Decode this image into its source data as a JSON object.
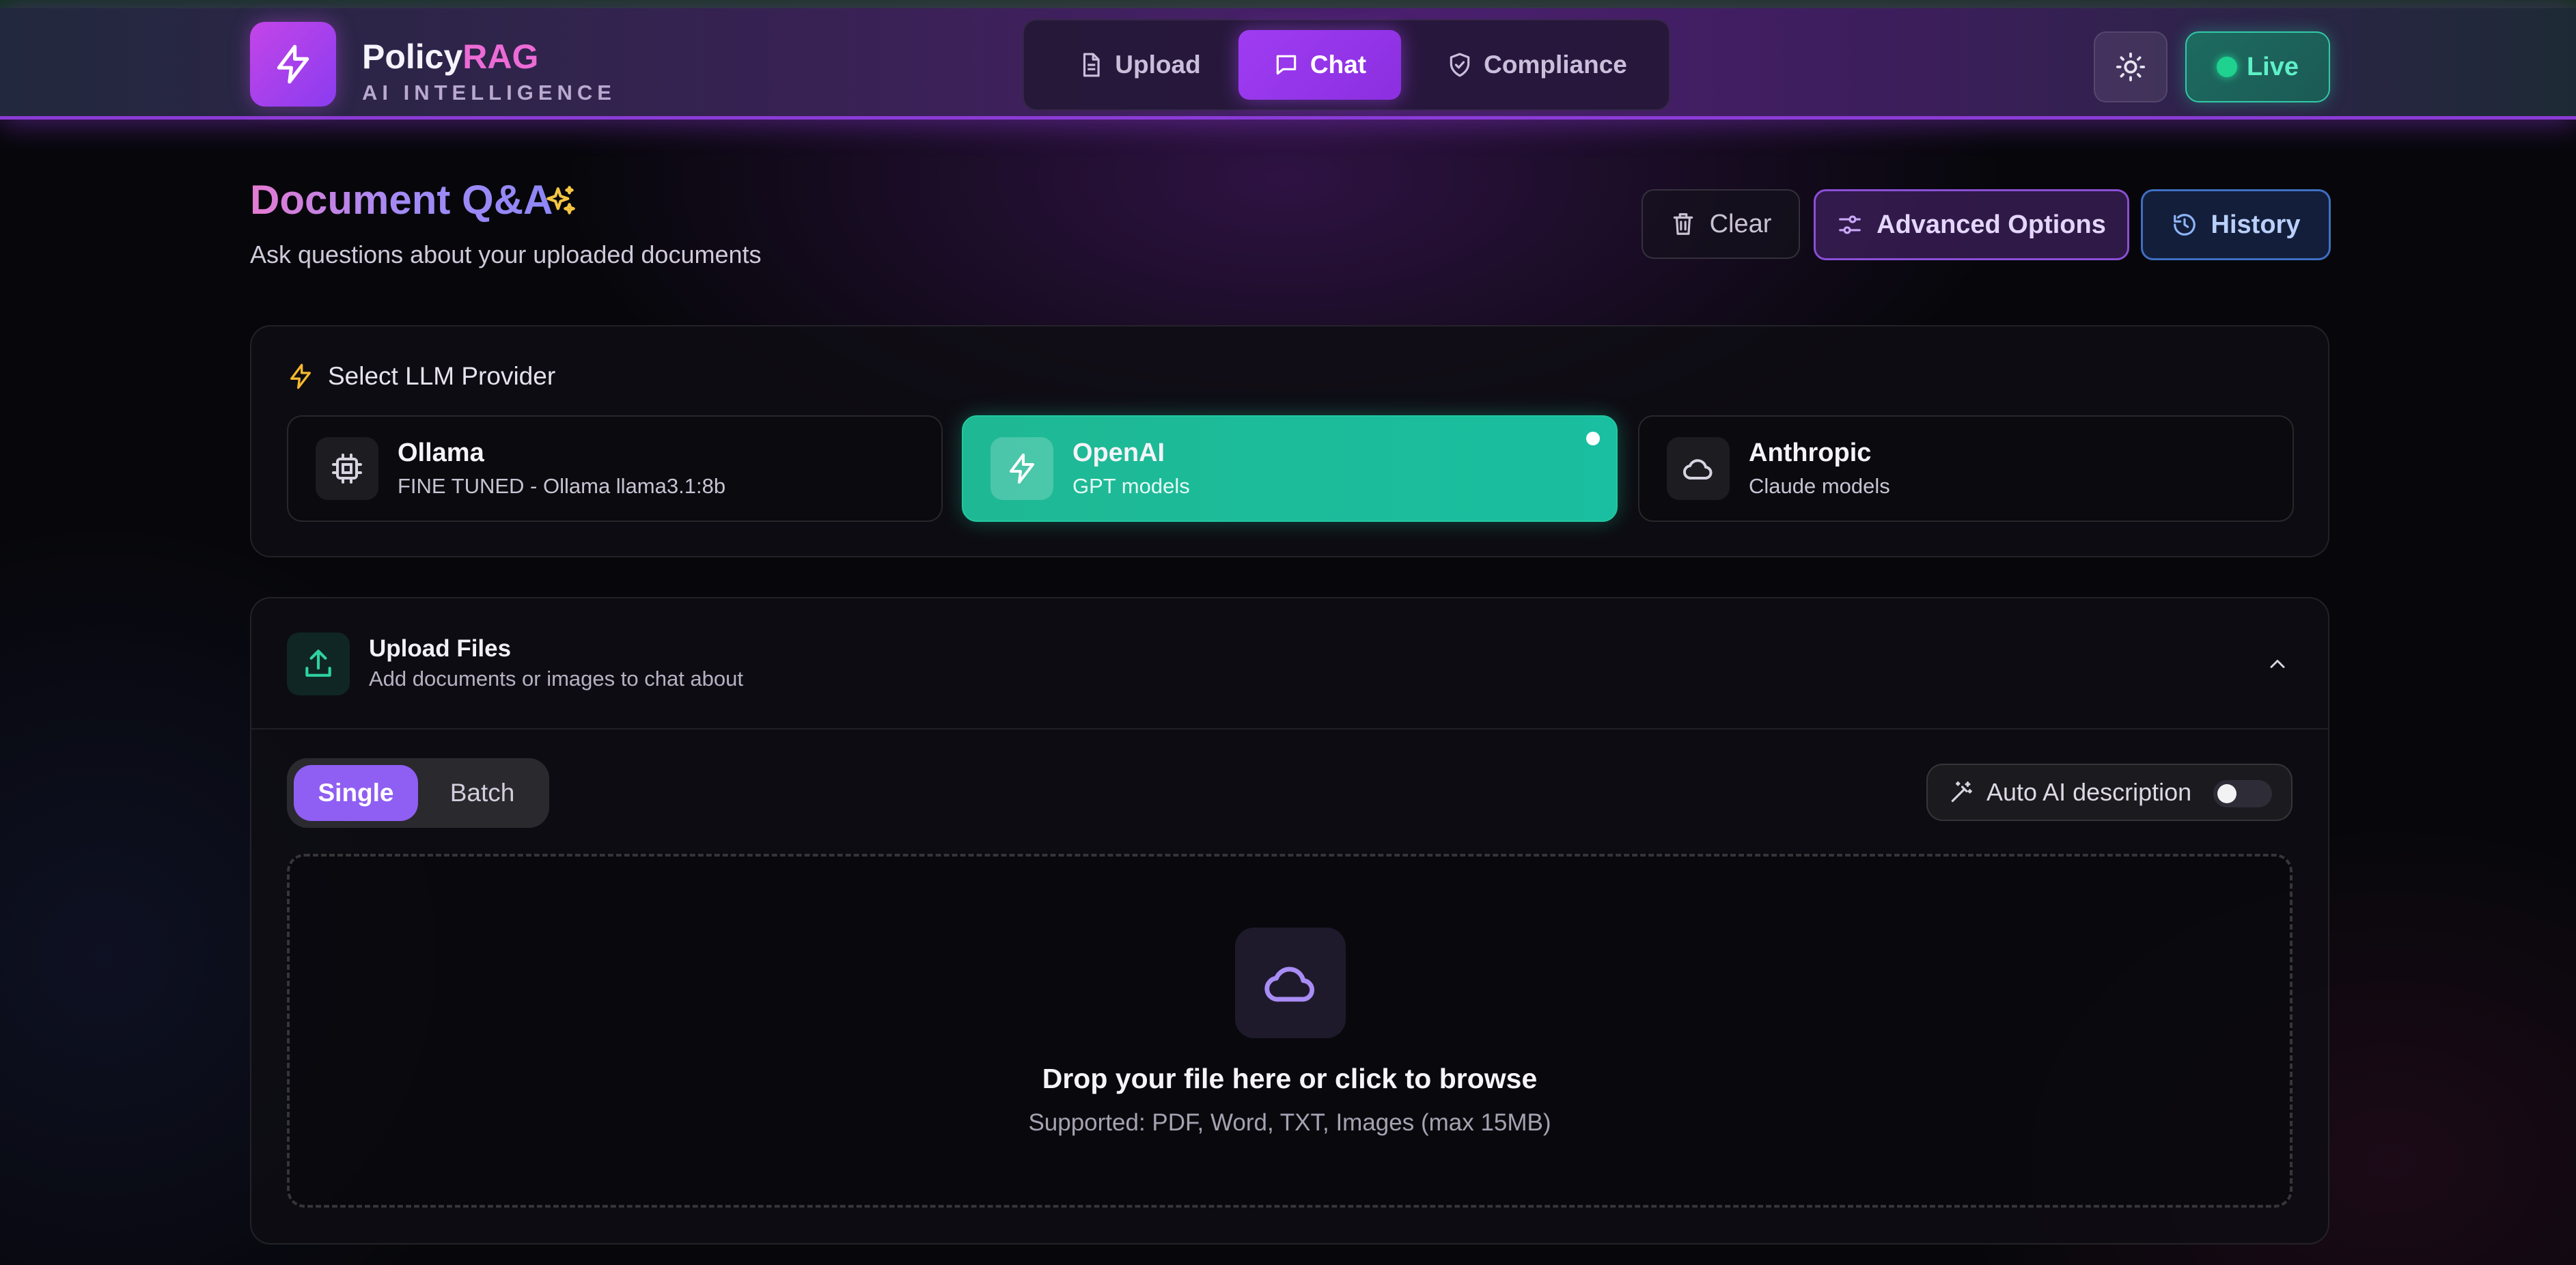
{
  "header": {
    "brand_part1": "Policy",
    "brand_part2": "RAG",
    "brand_subtitle": "AI INTELLIGENCE",
    "nav": [
      {
        "label": "Upload",
        "icon": "document-icon",
        "active": false
      },
      {
        "label": "Chat",
        "icon": "chat-bubble-icon",
        "active": true
      },
      {
        "label": "Compliance",
        "icon": "shield-check-icon",
        "active": false
      }
    ],
    "theme_toggle_icon": "sun-icon",
    "live_label": "Live"
  },
  "page": {
    "title": "Document Q&A",
    "subtitle": "Ask questions about your uploaded documents",
    "actions": {
      "clear_label": "Clear",
      "advanced_label": "Advanced Options",
      "history_label": "History"
    }
  },
  "llm": {
    "title": "Select LLM Provider",
    "providers": [
      {
        "name": "Ollama",
        "description": "FINE TUNED - Ollama llama3.1:8b",
        "icon": "cpu-chip-icon",
        "selected": false
      },
      {
        "name": "OpenAI",
        "description": "GPT models",
        "icon": "lightning-icon",
        "selected": true
      },
      {
        "name": "Anthropic",
        "description": "Claude models",
        "icon": "cloud-icon",
        "selected": false
      }
    ]
  },
  "upload": {
    "title": "Upload Files",
    "subtitle": "Add documents or images to chat about",
    "modes": [
      {
        "label": "Single",
        "active": true
      },
      {
        "label": "Batch",
        "active": false
      }
    ],
    "auto_ai_label": "Auto AI description",
    "auto_ai_enabled": false,
    "dropzone_title": "Drop your file here or click to browse",
    "dropzone_subtitle": "Supported: PDF, Word, TXT, Images (max 15MB)"
  },
  "colors": {
    "accent_purple": "#9f3cf2",
    "accent_teal": "#1fb894",
    "live_green": "#1fd28f",
    "brand_pink": "#ec6bd6"
  }
}
